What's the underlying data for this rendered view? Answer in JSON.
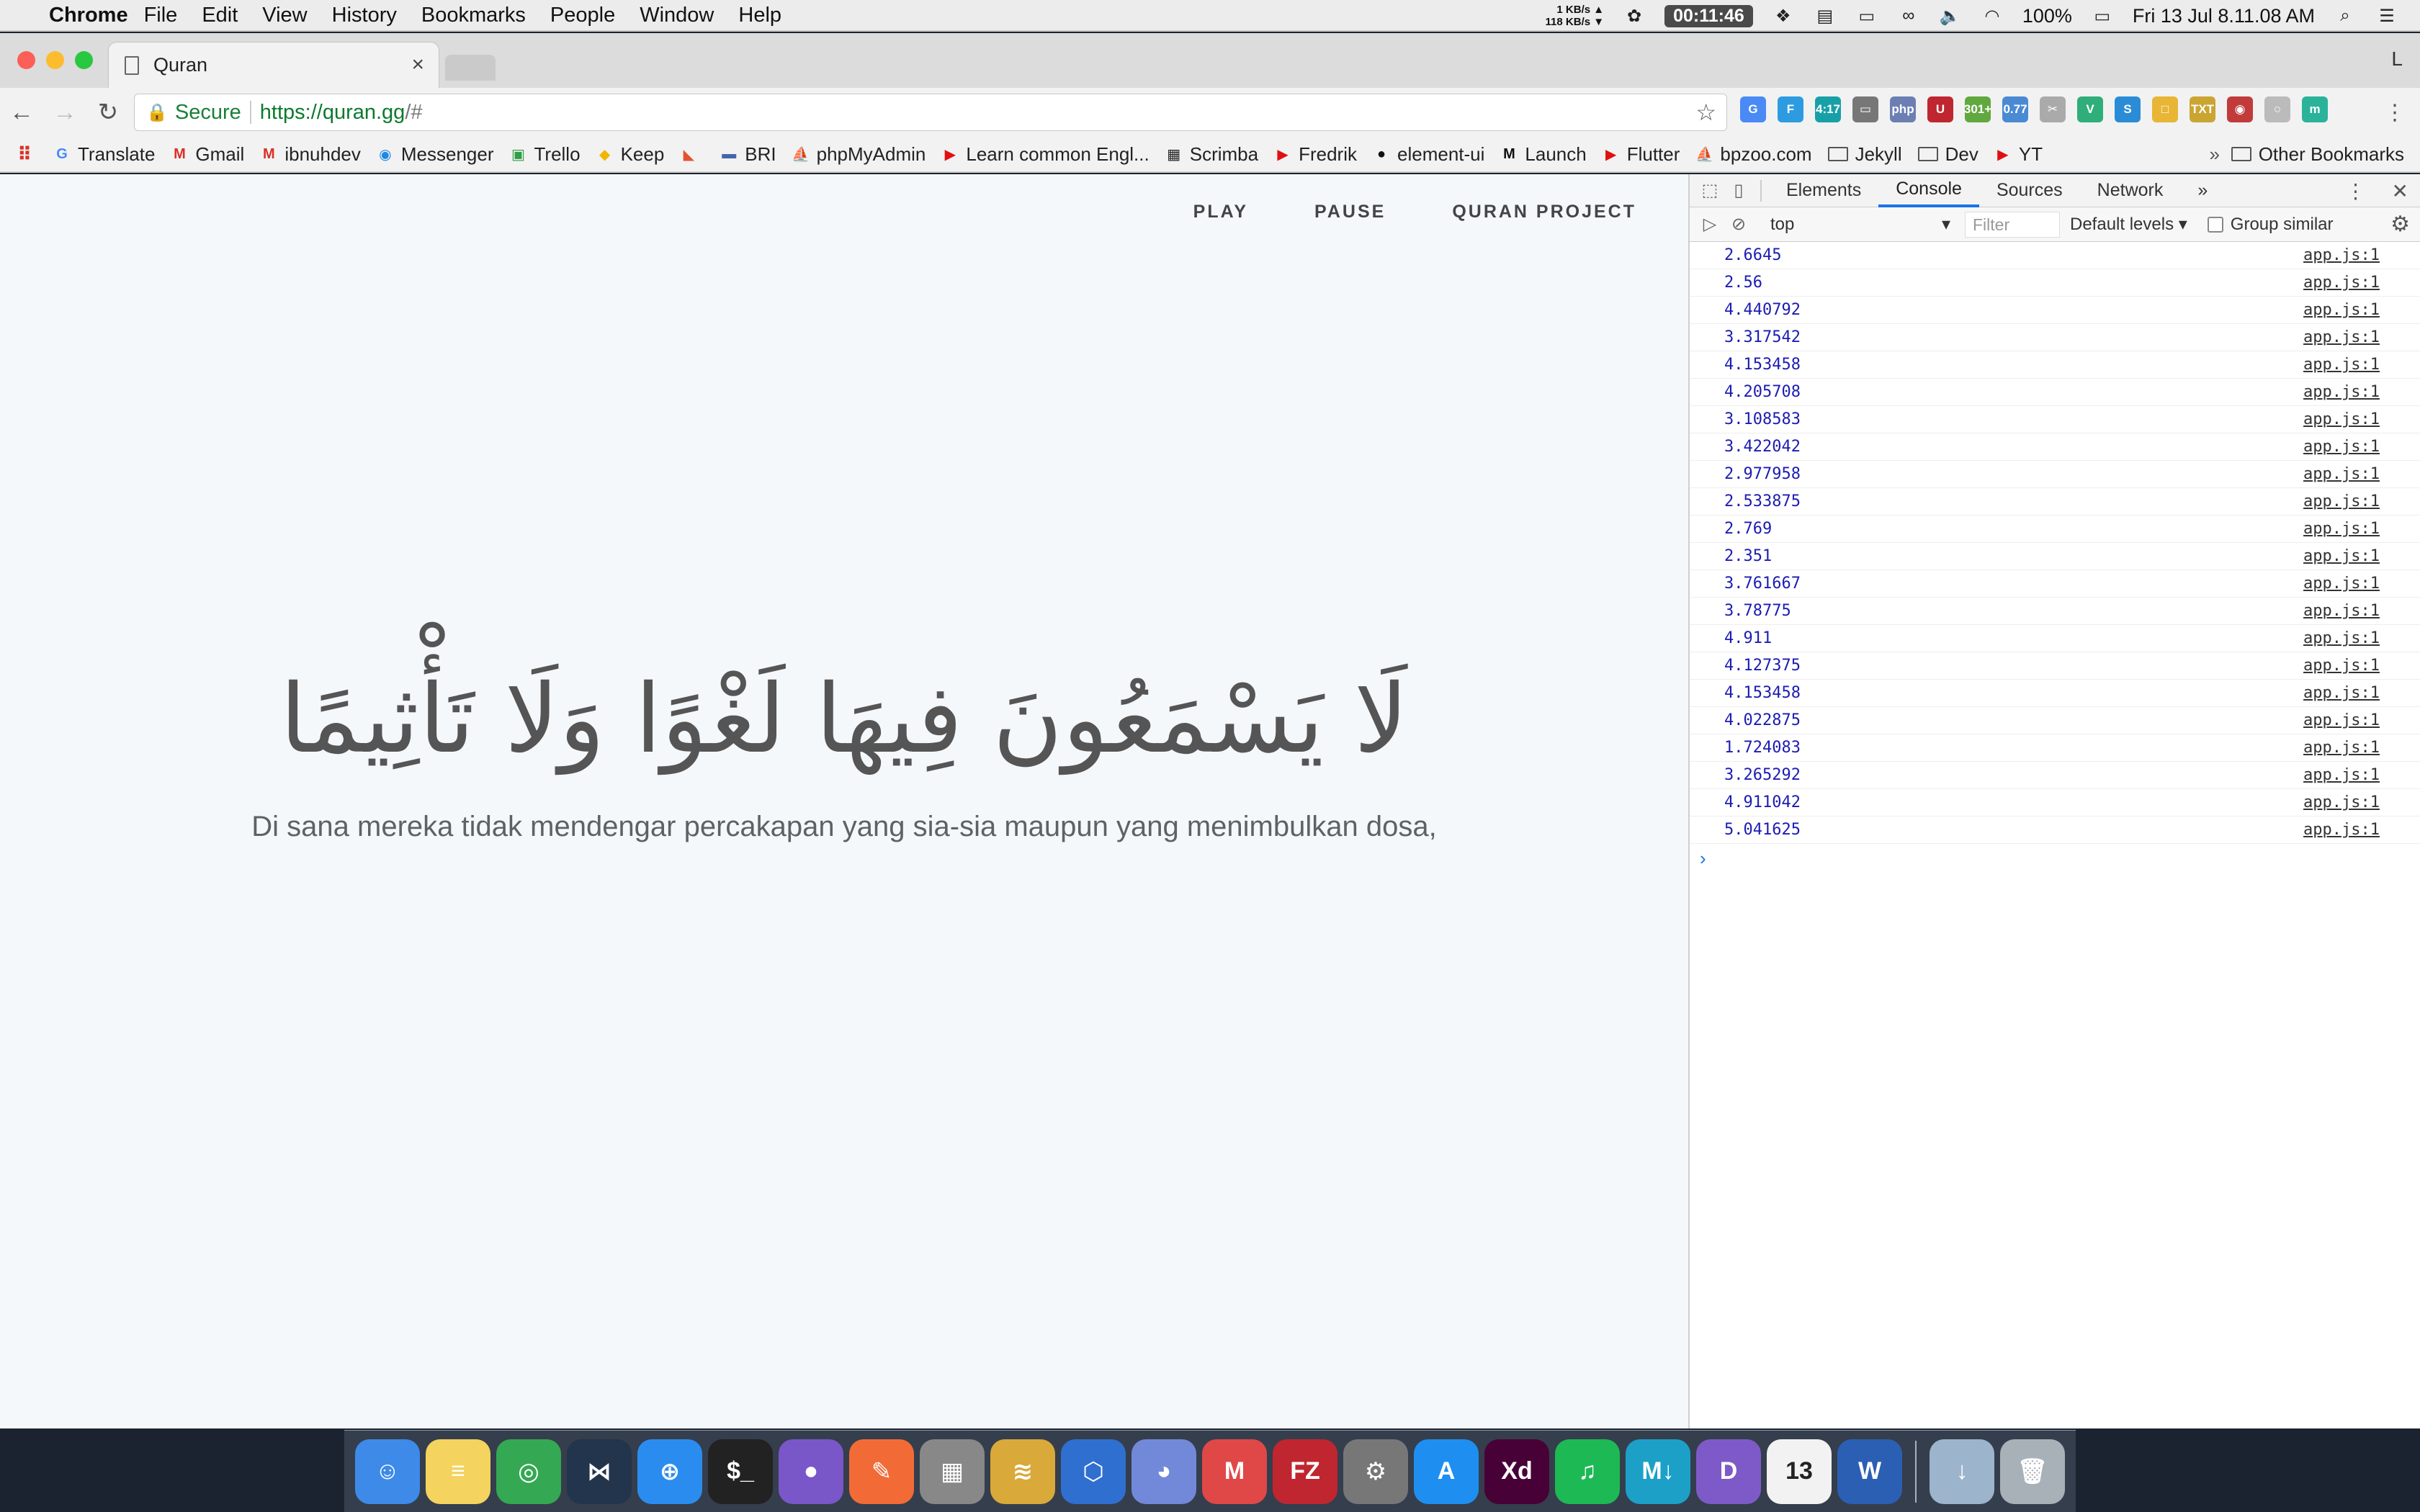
{
  "menubar": {
    "app_name": "Chrome",
    "items": [
      "File",
      "Edit",
      "View",
      "History",
      "Bookmarks",
      "People",
      "Window",
      "Help"
    ],
    "net_up": "1 KB/s",
    "net_down": "118 KB/s",
    "timer": "00:11:46",
    "battery": "100%",
    "datetime": "Fri 13 Jul  8.11.08 AM"
  },
  "tab": {
    "title": "Quran",
    "profile": "L"
  },
  "toolbar": {
    "secure_label": "Secure",
    "url_domain": "https://quran.gg",
    "url_rest": "/#"
  },
  "extensions": [
    {
      "label": "G",
      "color": "#4a8af4"
    },
    {
      "label": "F",
      "color": "#2d9be0"
    },
    {
      "label": "4:17",
      "color": "#18a0a8"
    },
    {
      "label": "▭",
      "color": "#777"
    },
    {
      "label": "php",
      "color": "#6b7fb3"
    },
    {
      "label": "U",
      "color": "#c0262f"
    },
    {
      "label": "301+",
      "color": "#61a83f"
    },
    {
      "label": "0.77",
      "color": "#4a8ad4"
    },
    {
      "label": "✂",
      "color": "#aaa"
    },
    {
      "label": "V",
      "color": "#2fae7a"
    },
    {
      "label": "S",
      "color": "#2a8cd6"
    },
    {
      "label": "□",
      "color": "#e8b535"
    },
    {
      "label": "TXT",
      "color": "#caa532"
    },
    {
      "label": "◉",
      "color": "#c23b3b"
    },
    {
      "label": "○",
      "color": "#bbb"
    },
    {
      "label": "m",
      "color": "#2ab39a"
    }
  ],
  "bookmarks": [
    {
      "label": "Translate",
      "icon": "G",
      "color": "#4a8af4"
    },
    {
      "label": "Gmail",
      "icon": "M",
      "color": "#d93025"
    },
    {
      "label": "ibnuhdev",
      "icon": "M",
      "color": "#d93025"
    },
    {
      "label": "Messenger",
      "icon": "◉",
      "color": "#1e88e5"
    },
    {
      "label": "Trello",
      "icon": "▣",
      "color": "#2f9e44"
    },
    {
      "label": "Keep",
      "icon": "◆",
      "color": "#f2b600"
    },
    {
      "label": "",
      "icon": "◣",
      "color": "#e2532d"
    },
    {
      "label": "BRI",
      "icon": "▬",
      "color": "#4466aa"
    },
    {
      "label": "phpMyAdmin",
      "icon": "⛵",
      "color": "#e58a1a"
    },
    {
      "label": "Learn common Engl...",
      "icon": "▶",
      "color": "#e01010"
    },
    {
      "label": "Scrimba",
      "icon": "▦",
      "color": "#222"
    },
    {
      "label": "Fredrik",
      "icon": "▶",
      "color": "#e01010"
    },
    {
      "label": "element-ui",
      "icon": "●",
      "color": "#111"
    },
    {
      "label": "Launch",
      "icon": "M",
      "color": "#111"
    },
    {
      "label": "Flutter",
      "icon": "▶",
      "color": "#e01010"
    },
    {
      "label": "bpzoo.com",
      "icon": "⛵",
      "color": "#e58a1a"
    },
    {
      "label": "Jekyll",
      "icon": "folder",
      "color": "#555"
    },
    {
      "label": "Dev",
      "icon": "folder",
      "color": "#555"
    },
    {
      "label": "YT",
      "icon": "▶",
      "color": "#e01010"
    }
  ],
  "bookmarks_more": "»",
  "other_bookmarks": "Other Bookmarks",
  "page": {
    "nav": [
      "PLAY",
      "PAUSE",
      "QURAN PROJECT"
    ],
    "arabic": "لَا يَسْمَعُونَ فِيهَا لَغْوًا وَلَا تَأْثِيمًا",
    "translation": "Di sana mereka tidak mendengar percakapan yang sia-sia maupun yang menimbulkan dosa,"
  },
  "devtools": {
    "tabs": [
      "Elements",
      "Console",
      "Sources",
      "Network"
    ],
    "active_tab": "Console",
    "context": "top",
    "filter_placeholder": "Filter",
    "levels": "Default levels",
    "group_similar": "Group similar",
    "logs": [
      {
        "value": "2.6645",
        "source": "app.js:1"
      },
      {
        "value": "2.56",
        "source": "app.js:1"
      },
      {
        "value": "4.440792",
        "source": "app.js:1"
      },
      {
        "value": "3.317542",
        "source": "app.js:1"
      },
      {
        "value": "4.153458",
        "source": "app.js:1"
      },
      {
        "value": "4.205708",
        "source": "app.js:1"
      },
      {
        "value": "3.108583",
        "source": "app.js:1"
      },
      {
        "value": "3.422042",
        "source": "app.js:1"
      },
      {
        "value": "2.977958",
        "source": "app.js:1"
      },
      {
        "value": "2.533875",
        "source": "app.js:1"
      },
      {
        "value": "2.769",
        "source": "app.js:1"
      },
      {
        "value": "2.351",
        "source": "app.js:1"
      },
      {
        "value": "3.761667",
        "source": "app.js:1"
      },
      {
        "value": "3.78775",
        "source": "app.js:1"
      },
      {
        "value": "4.911",
        "source": "app.js:1"
      },
      {
        "value": "4.127375",
        "source": "app.js:1"
      },
      {
        "value": "4.153458",
        "source": "app.js:1"
      },
      {
        "value": "4.022875",
        "source": "app.js:1"
      },
      {
        "value": "1.724083",
        "source": "app.js:1"
      },
      {
        "value": "3.265292",
        "source": "app.js:1"
      },
      {
        "value": "4.911042",
        "source": "app.js:1"
      },
      {
        "value": "5.041625",
        "source": "app.js:1"
      }
    ],
    "prompt": "›"
  },
  "dock": [
    {
      "name": "finder",
      "label": "☺",
      "color": "#3d8ae8"
    },
    {
      "name": "notes",
      "label": "≡",
      "color": "#f4d35e"
    },
    {
      "name": "chrome",
      "label": "◎",
      "color": "#34a853"
    },
    {
      "name": "vscode",
      "label": "⋈",
      "color": "#23344d"
    },
    {
      "name": "safari",
      "label": "⊕",
      "color": "#2b8cf0"
    },
    {
      "name": "terminal",
      "label": "$_",
      "color": "#222"
    },
    {
      "name": "github",
      "label": "●",
      "color": "#7a57c8"
    },
    {
      "name": "postman",
      "label": "✎",
      "color": "#f26b37"
    },
    {
      "name": "calculator",
      "label": "▦",
      "color": "#888"
    },
    {
      "name": "sequel",
      "label": "≋",
      "color": "#d9a93a"
    },
    {
      "name": "network",
      "label": "⬡",
      "color": "#2f6fd0"
    },
    {
      "name": "discord",
      "label": "◕",
      "color": "#7289da"
    },
    {
      "name": "mailspring",
      "label": "M",
      "color": "#e04848"
    },
    {
      "name": "filezilla",
      "label": "FZ",
      "color": "#c0262f"
    },
    {
      "name": "system-preferences",
      "label": "⚙",
      "color": "#777"
    },
    {
      "name": "app-store",
      "label": "A",
      "color": "#1e8ff0"
    },
    {
      "name": "adobe-xd",
      "label": "Xd",
      "color": "#470137"
    },
    {
      "name": "spotify",
      "label": "♫",
      "color": "#1db954"
    },
    {
      "name": "markdown",
      "label": "M↓",
      "color": "#1ca0c8"
    },
    {
      "name": "docs",
      "label": "D",
      "color": "#7e5ac8"
    },
    {
      "name": "calendar",
      "label": "13",
      "color": "#f2f2f2"
    },
    {
      "name": "word",
      "label": "W",
      "color": "#2b5fb3"
    },
    {
      "name": "downloads",
      "label": "↓",
      "color": "#9cb4cc"
    },
    {
      "name": "trash",
      "label": "🗑",
      "color": "#a8b0b8"
    }
  ]
}
